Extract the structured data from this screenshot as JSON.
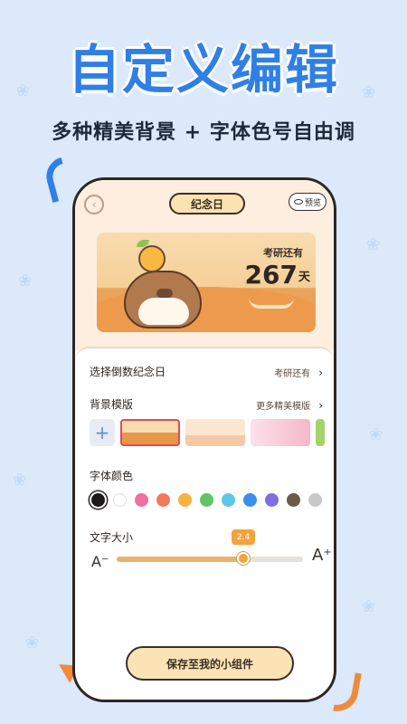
{
  "hero": {
    "title": "自定义编辑",
    "subtitle": "多种精美背景 + 字体色号自由调"
  },
  "phone": {
    "header": {
      "back_icon": "back-arrow-icon",
      "title": "纪念日",
      "preview_label": "预览",
      "preview_icon": "eye-icon"
    },
    "card": {
      "label": "考研还有",
      "number": "267",
      "unit": "天"
    },
    "settings": {
      "countdown_label": "选择倒数纪念日",
      "countdown_value": "考研还有",
      "template_label": "背景模版",
      "template_more": "更多精美模版",
      "templates": [
        "add",
        "capybara-orange",
        "bear-beige",
        "pink-strawberry",
        "green"
      ],
      "selected_template": 1,
      "font_color_label": "字体颜色",
      "font_colors": [
        "#1a1a1a",
        "#ffffff",
        "#f06ea0",
        "#f07a5a",
        "#f7b33d",
        "#5fc46a",
        "#5cc6e8",
        "#3c8fe8",
        "#7e6ee0",
        "#6b5a48",
        "#c8c8c8"
      ],
      "selected_font_color": 0,
      "text_size_label": "文字大小",
      "text_size_small_glyph": "A⁻",
      "text_size_large_glyph": "A⁺",
      "text_size_value": "2.4",
      "text_size_fraction": 0.68
    },
    "save_button": "保存至我的小组件"
  },
  "colors": {
    "accent_blue": "#2f7fe6",
    "accent_orange": "#f3a33d",
    "background": "#dbe9fb"
  }
}
